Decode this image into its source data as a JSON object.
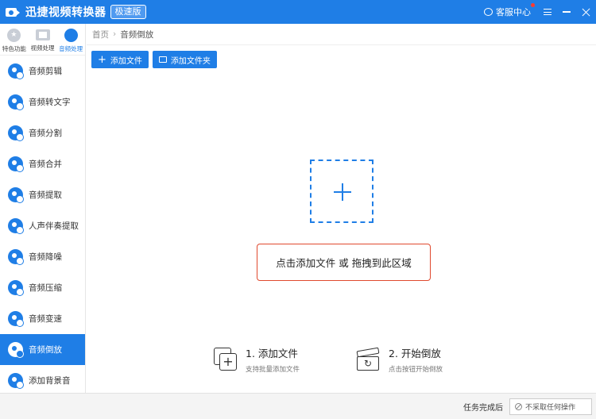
{
  "titlebar": {
    "app_title": "迅捷视频转换器",
    "edition": "极速版",
    "service_label": "客服中心"
  },
  "sidebar": {
    "categories": [
      {
        "label": "特色功能",
        "icon": "star-icon",
        "active": false
      },
      {
        "label": "视频处理",
        "icon": "film-icon",
        "active": false
      },
      {
        "label": "音频处理",
        "icon": "audio-disc-icon",
        "active": true
      }
    ],
    "items": [
      {
        "label": "音频剪辑"
      },
      {
        "label": "音频转文字"
      },
      {
        "label": "音频分割"
      },
      {
        "label": "音频合并"
      },
      {
        "label": "音频提取"
      },
      {
        "label": "人声伴奏提取"
      },
      {
        "label": "音频降噪"
      },
      {
        "label": "音频压缩"
      },
      {
        "label": "音频变速"
      },
      {
        "label": "音频倒放",
        "active": true
      },
      {
        "label": "添加背景音"
      }
    ]
  },
  "breadcrumb": {
    "home": "首页",
    "separator": "›",
    "current": "音频倒放"
  },
  "toolbar": {
    "add_file": "添加文件",
    "add_folder": "添加文件夹"
  },
  "dropzone": {
    "hint": "点击添加文件 或 拖拽到此区域"
  },
  "steps": [
    {
      "title": "1. 添加文件",
      "subtitle": "支持批量添加文件"
    },
    {
      "title": "2. 开始倒放",
      "subtitle": "点击按钮开始倒放"
    }
  ],
  "statusbar": {
    "after_label": "任务完成后",
    "after_value": "不采取任何操作"
  }
}
